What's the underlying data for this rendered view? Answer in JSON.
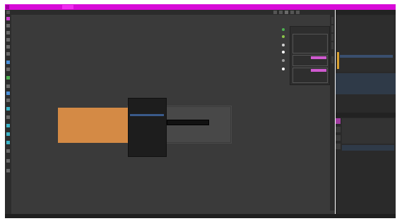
{
  "app": {
    "title": "",
    "colors": {
      "titlebar": "#d80ad8",
      "editor_bg": "#3a3a3a",
      "grid_line": "#2f2f2f",
      "panel_bg": "#2e2e2e",
      "outliner_bg": "#2a2a2a",
      "selected_object": "#d48a45",
      "selection_highlight": "#3a4f6e",
      "menu_bg": "#1d1d1d"
    }
  },
  "menubar": {
    "items": [
      "",
      "",
      "",
      "",
      "",
      "",
      "",
      "",
      "",
      "",
      "",
      ""
    ],
    "right_text": ""
  },
  "viewport_header": {
    "items": [
      "",
      "",
      "",
      "",
      "",
      "",
      "",
      ""
    ]
  },
  "toolbar": {
    "tools": [
      "select-box-icon",
      "cursor-icon",
      "move-icon",
      "rotate-icon",
      "scale-icon",
      "transform-icon",
      "annotate-icon",
      "measure-icon",
      "add-cube-icon",
      "extrude-icon",
      "inset-icon",
      "bevel-icon",
      "loopcut-icon",
      "knife-icon",
      "polybuild-icon",
      "spin-icon",
      "smooth-icon",
      "shrink-icon",
      "shear-icon",
      "rip-icon"
    ]
  },
  "properties_overlay": {
    "lines": [
      "",
      "",
      "",
      "",
      "",
      ""
    ]
  },
  "n_panel": {
    "tabs": [
      "",
      "",
      ""
    ],
    "rows": [
      "",
      "",
      "",
      "",
      "",
      "",
      "",
      "",
      "",
      ""
    ],
    "dots": [
      "#4caf50",
      "#8bc34a",
      "#d0d0d0",
      "#ffffff",
      "#9e9e9e",
      "#ffffff"
    ]
  },
  "context_menu": {
    "title": "",
    "items": [
      "",
      "",
      "",
      "",
      "",
      "",
      "",
      "",
      "",
      "",
      "",
      ""
    ],
    "highlighted_index": 2
  },
  "tooltip": {
    "text": ""
  },
  "outliner": {
    "title": "",
    "rows": [
      "",
      "",
      "",
      "",
      "",
      "",
      "",
      "",
      "",
      "",
      "",
      "",
      ""
    ]
  },
  "properties_editor": {
    "title": "",
    "tabs": [
      "",
      "",
      ""
    ],
    "rows": [
      "",
      "",
      "",
      ""
    ]
  },
  "statusbar": {
    "left_items": [
      "",
      "",
      ""
    ],
    "center_text": "",
    "right_text": ""
  }
}
